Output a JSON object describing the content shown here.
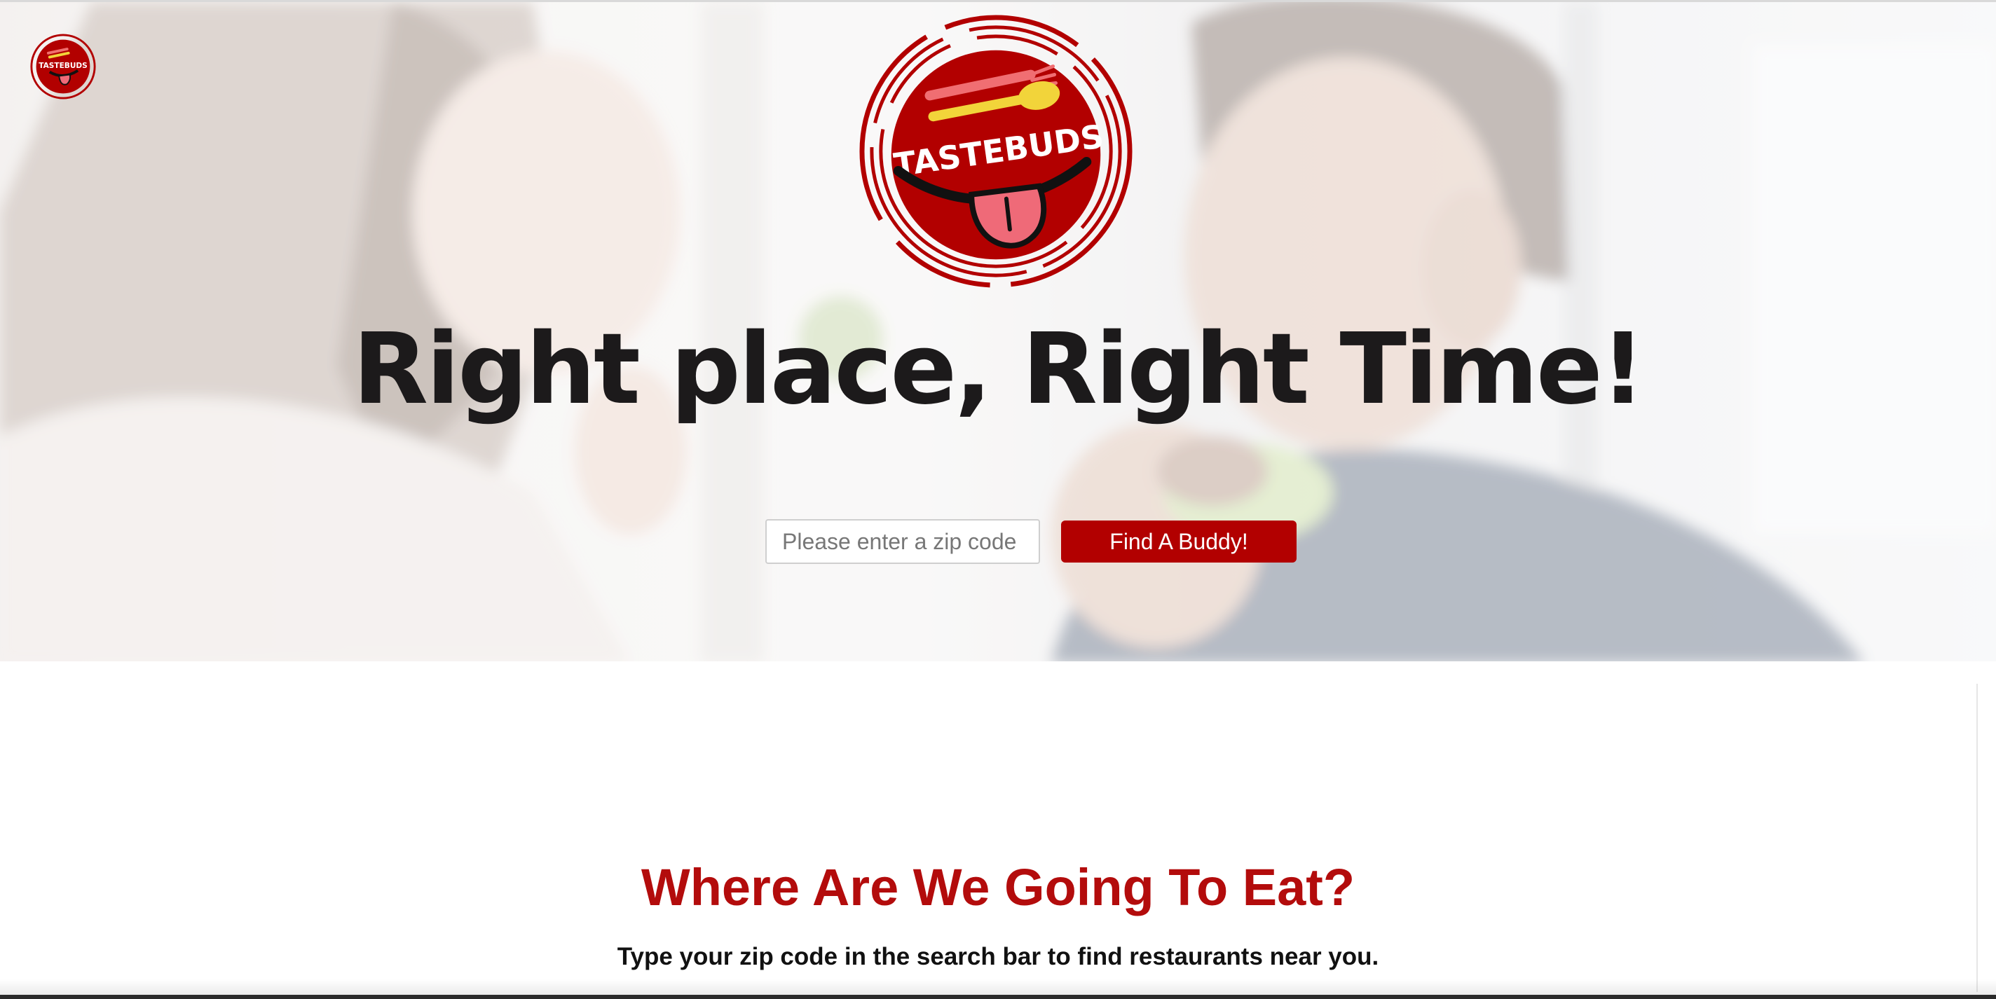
{
  "brand": {
    "name": "TASTEBUDS",
    "accent_color": "#b20000",
    "title_color": "#b30c0c"
  },
  "hero": {
    "headline": "Right place, Right Time!",
    "search": {
      "placeholder": "Please enter a zip code",
      "value": ""
    },
    "find_button_label": "Find A Buddy!"
  },
  "section": {
    "title": "Where Are We Going To Eat?",
    "subtitle": "Type your zip code in the search bar to find restaurants near you."
  },
  "icons": [
    "tastebuds-logo-icon",
    "fork-icon",
    "spoon-icon",
    "tongue-icon"
  ]
}
